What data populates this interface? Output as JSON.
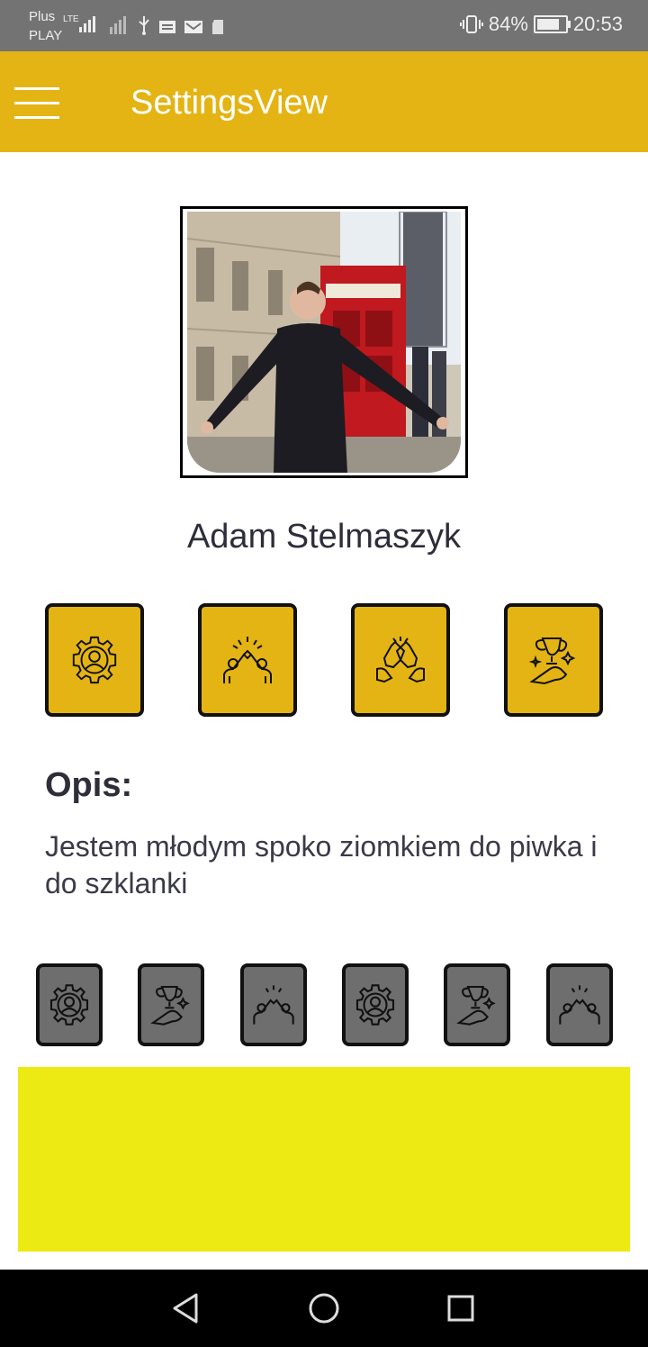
{
  "status_bar": {
    "carrier_line1": "Plus",
    "carrier_line2": "PLAY",
    "network": "LTE",
    "battery": "84%",
    "battery_level": 0.84,
    "time": "20:53"
  },
  "app_bar": {
    "title": "SettingsView",
    "menu_icon": "hamburger-menu-icon"
  },
  "profile": {
    "name": "Adam Stelmaszyk",
    "photo_icon": "profile-photo"
  },
  "badges": [
    {
      "icon": "gear-person-icon"
    },
    {
      "icon": "high-five-icon"
    },
    {
      "icon": "beer-cheers-icon"
    },
    {
      "icon": "trophy-hand-icon"
    }
  ],
  "description": {
    "label": "Opis:",
    "text": "Jestem młodym spoko ziomkiem do piwka i do szklanki"
  },
  "small_badges": [
    {
      "icon": "gear-person-icon"
    },
    {
      "icon": "trophy-hand-icon"
    },
    {
      "icon": "high-five-icon"
    },
    {
      "icon": "gear-person-icon"
    },
    {
      "icon": "trophy-hand-icon"
    },
    {
      "icon": "high-five-icon"
    }
  ],
  "colors": {
    "status_bar": "#737373",
    "app_bar": "#E4B414",
    "badge": "#E4B414",
    "badge_inactive": "#6e6e6e",
    "yellow_box": "#EDE912"
  },
  "nav": {
    "back_icon": "back-triangle-icon",
    "home_icon": "home-circle-icon",
    "recents_icon": "recents-square-icon"
  }
}
